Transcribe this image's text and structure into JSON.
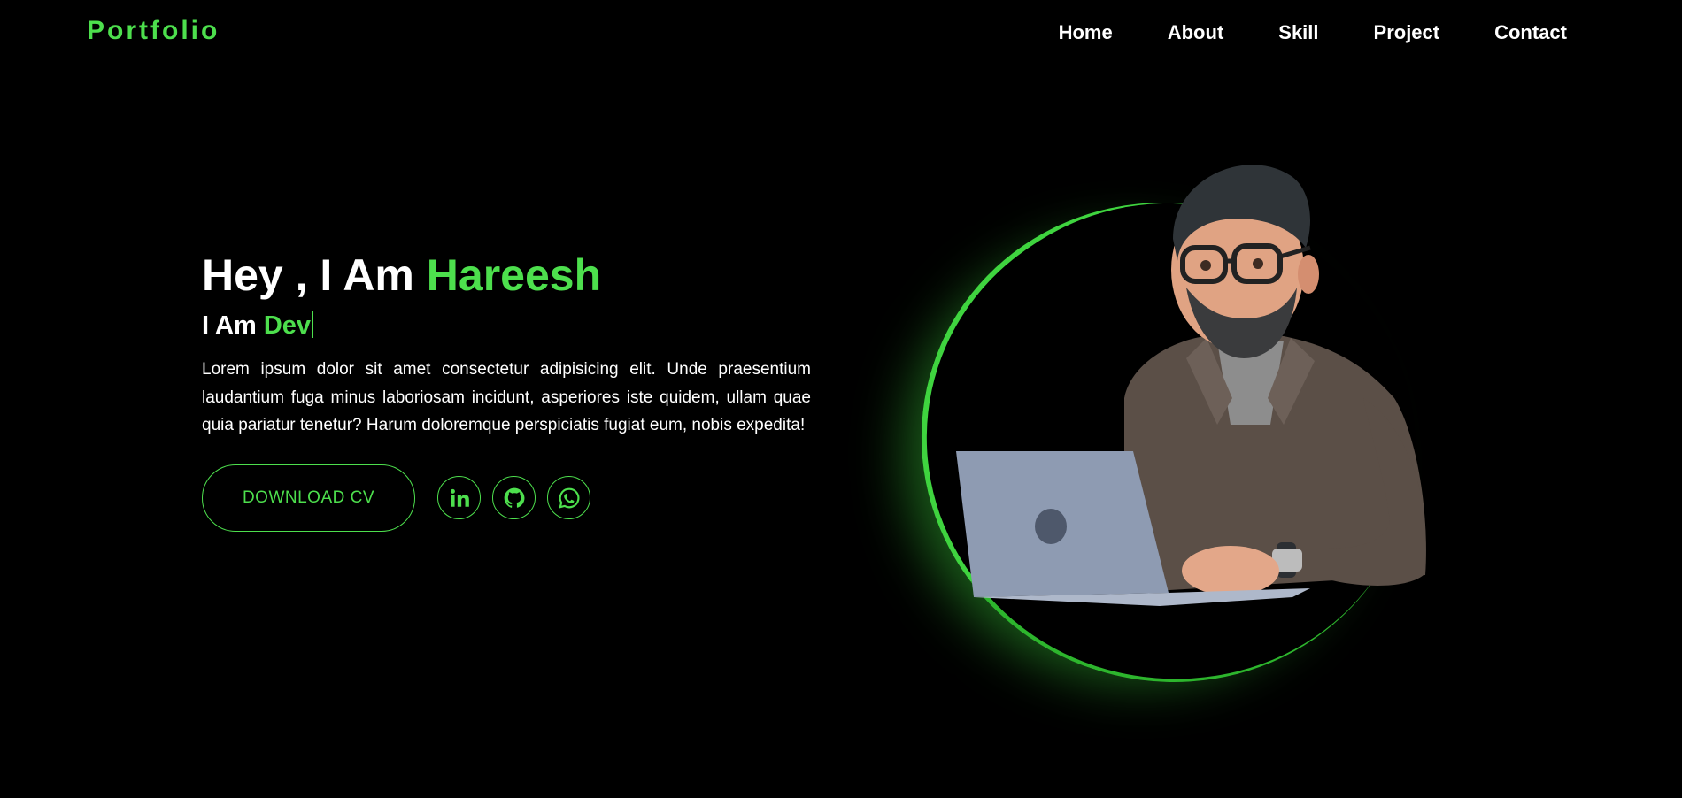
{
  "header": {
    "logo": "Portfolio",
    "nav": [
      "Home",
      "About",
      "Skill",
      "Project",
      "Contact"
    ]
  },
  "hero": {
    "title_prefix": "Hey , I Am ",
    "title_name": "Hareesh",
    "subtitle_prefix": "I Am ",
    "subtitle_typed": "Dev",
    "description": "Lorem ipsum dolor sit amet consectetur adipisicing elit. Unde praesentium laudantium fuga minus laboriosam incidunt, asperiores iste quidem, ullam quae quia pariatur tenetur? Harum doloremque perspiciatis fugiat eum, nobis expedita!",
    "cv_button": "DOWNLOAD CV",
    "socials": [
      "linkedin-icon",
      "github-icon",
      "whatsapp-icon"
    ]
  },
  "colors": {
    "accent": "#4ddf4d",
    "background": "#000000",
    "text": "#ffffff"
  }
}
